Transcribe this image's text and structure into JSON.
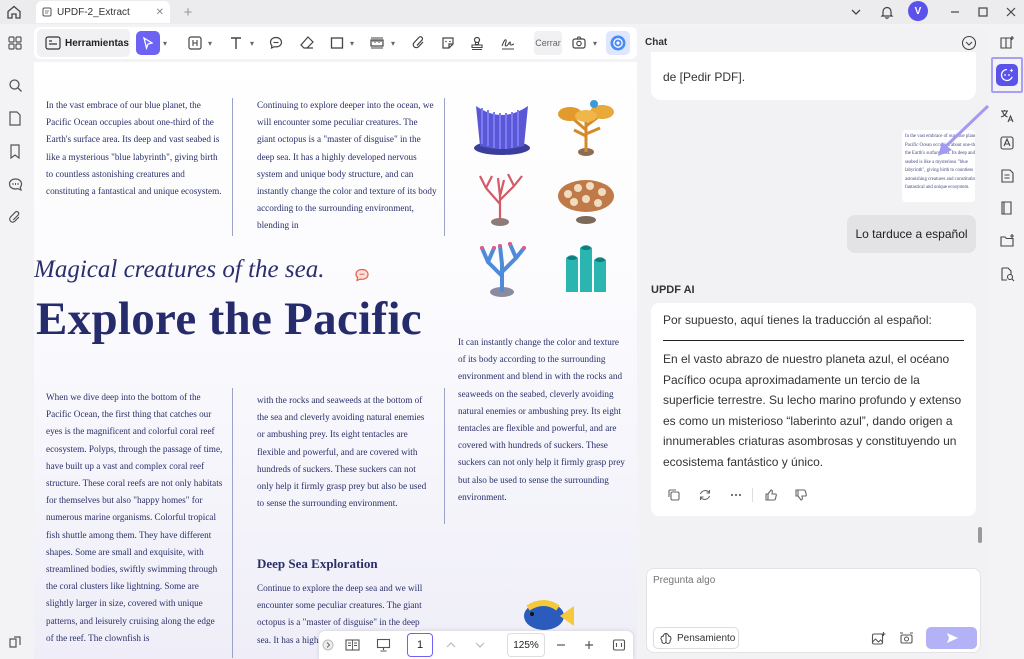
{
  "tab": {
    "title": "UPDF-2_Extract"
  },
  "user": {
    "avatar_letter": "V"
  },
  "toolbar": {
    "tools_label": "Herramientas",
    "close_label": "Cerrar"
  },
  "document": {
    "col1_top": "In the vast embrace of our blue planet, the Pacific Ocean occupies about one-third of the Earth's surface area. Its deep and vast seabed is like a mysterious \"blue labyrinth\", giving birth to countless astonishing creatures and constituting a fantastical and unique ecosystem.",
    "col2_top": "Continuing to explore deeper into the ocean, we will encounter some peculiar creatures. The giant octopus is a \"master of disguise\" in the deep sea. It has a highly developed nervous system and unique body structure, and can instantly change the color and texture of its body according to the surrounding environment, blending in",
    "subtitle": "Magical creatures of the sea.",
    "title": "Explore the Pacific",
    "col3_mid": "It can instantly change the color and texture of its body according to the surrounding environment and blend in with the rocks and seaweeds on the seabed, cleverly avoiding natural enemies or ambushing prey. Its eight tentacles are flexible and powerful, and are covered with hundreds of suckers. These suckers can not only help it firmly grasp prey but also be used to sense the surrounding environment.",
    "col1_bottom": "When we dive deep into the bottom of the Pacific Ocean, the first thing that catches our eyes is the magnificent and colorful coral reef ecosystem. Polyps, through the passage of time, have built up a vast and complex coral reef structure. These coral reefs are not only habitats for themselves but also \"happy homes\" for numerous marine organisms. Colorful tropical fish shuttle among them. They have different shapes. Some are small and exquisite, with streamlined bodies, swiftly swimming through the coral clusters like lightning. Some are slightly larger in size, covered with unique patterns, and leisurely cruising along the edge of the reef. The clownfish is",
    "col2_bottom": "with the rocks and seaweeds at the bottom of the sea and cleverly avoiding natural enemies or ambushing prey. Its eight tentacles are flexible and powerful, and are covered with hundreds of suckers. These suckers can not only help it firmly grasp prey but also be used to sense the surrounding environment.",
    "deep_heading": "Deep Sea Exploration",
    "deep_text": "Continue to explore the deep sea and we will encounter some peculiar creatures. The giant octopus is a \"master of disguise\" in the deep sea. It has a highly developed nervous system"
  },
  "bottom_nav": {
    "page": "1",
    "zoom": "125%"
  },
  "chat": {
    "title": "Chat",
    "previous_message_tail": "de [Pedir PDF].",
    "thumbnail_lines": [
      "In the vast embrace of our blue planet, the",
      "Pacific Ocean occupies about one-third of",
      "the Earth's surface area. Its deep and vast",
      "seabed is like a mysterious \"blue",
      "labyrinth\", giving birth to countless",
      "astonishing creatures and constituting a",
      "fantastical and unique ecosystem."
    ],
    "user_message": "Lo tarduce a español",
    "assistant_label": "UPDF AI",
    "assistant_intro": "Por supuesto, aquí tienes la traducción al español:",
    "assistant_body": "En el vasto abrazo de nuestro planeta azul, el océano Pacífico ocupa aproximadamente un tercio de la superficie terrestre. Su lecho marino profundo y extenso es como un misterioso “laberinto azul”, dando origen a innumerables criaturas asombrosas y constituyendo un ecosistema fantástico y único.",
    "input_placeholder": "Pregunta algo",
    "thinking_label": "Pensamiento"
  },
  "colors": {
    "accent": "#6c63f5",
    "doc_text": "#2a2f6a",
    "send_disabled": "#b4b2f6"
  }
}
